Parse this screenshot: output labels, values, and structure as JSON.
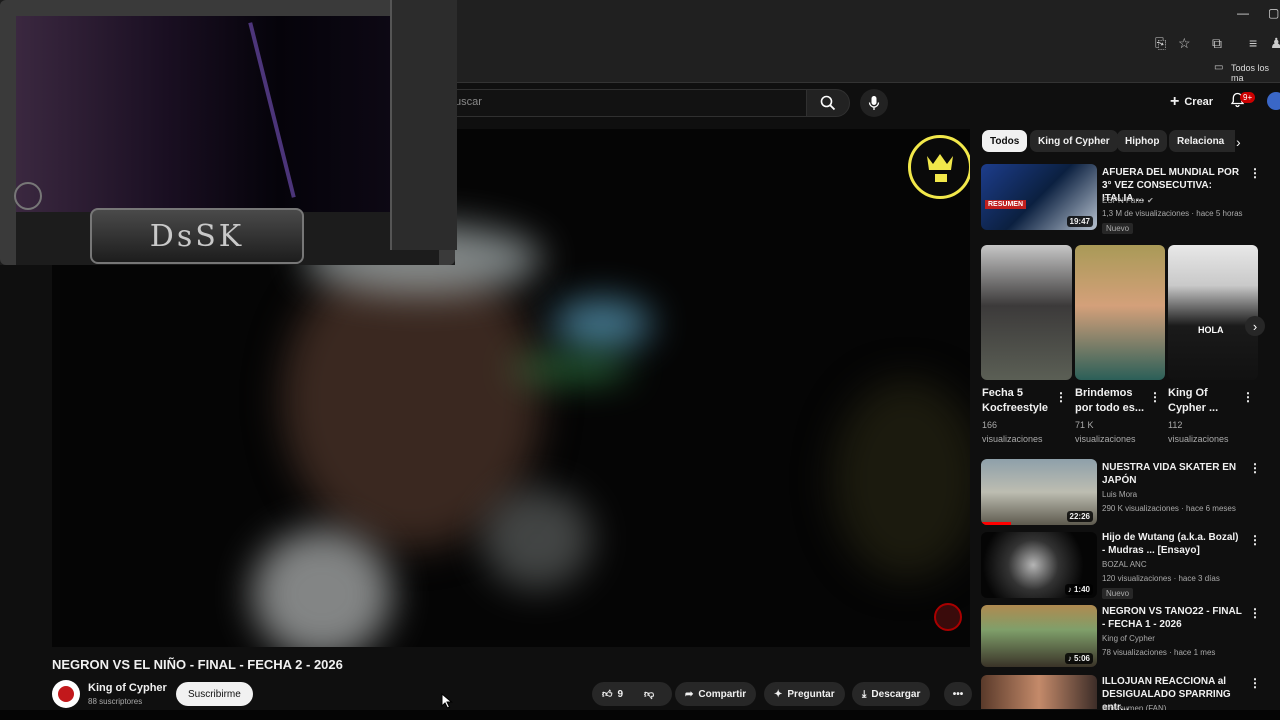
{
  "browser": {
    "bookmark_label": "Todos los ma",
    "bookmark_icon": "folder-icon"
  },
  "header": {
    "search_placeholder": "uscar",
    "create_label": "Crear",
    "notif_badge": "9+"
  },
  "video": {
    "title": "NEGRON VS EL NIÑO - FINAL - FECHA 2 - 2026",
    "overlay_logo_text": "DsSK"
  },
  "channel": {
    "name": "King of Cypher",
    "subs": "88 suscriptores",
    "subscribe_label": "Suscribirme"
  },
  "actions": {
    "likes": "9",
    "share": "Compartir",
    "ask": "Preguntar",
    "download": "Descargar"
  },
  "chips": [
    {
      "label": "Todos",
      "active": true
    },
    {
      "label": "King of Cypher"
    },
    {
      "label": "Hiphop"
    },
    {
      "label": "Relaciona"
    }
  ],
  "recommended": [
    {
      "title": "AFUERA DEL MUNDIAL POR 3° VEZ CONSECUTIVA: ITALIA ...",
      "channel": "ESPN Fans",
      "meta": "1,3 M de visualizaciones · hace 5 horas",
      "badge": "Nuevo",
      "duration": "19:47",
      "thumb_label": "RESUMEN"
    },
    {
      "title": "NUESTRA VIDA SKATER EN JAPÓN",
      "channel": "Luis Mora",
      "meta": "290 K visualizaciones · hace 6 meses",
      "badge": "",
      "duration": "22:26"
    },
    {
      "title": "Hijo de Wutang (a.k.a. Bozal) - Mudras ... [Ensayo]",
      "channel": "BOZAL ANC",
      "meta": "120 visualizaciones · hace 3 días",
      "badge": "Nuevo",
      "duration": "1:40"
    },
    {
      "title": "NEGRON VS TANO22 - FINAL - FECHA 1 - 2026",
      "channel": "King of Cypher",
      "meta": "78 visualizaciones · hace 1 mes",
      "badge": "",
      "duration": "5:06"
    },
    {
      "title": "ILLOJUAN REACCIONA al DESIGUALADO SPARRING entr...",
      "channel": "Illoresumen (FAN)",
      "meta": "",
      "badge": "",
      "duration": ""
    }
  ],
  "shorts": [
    {
      "title1": "Fecha 5",
      "title2": "Kocfreestyle",
      "views1": "166",
      "views2": "visualizaciones"
    },
    {
      "title1": "Brindemos",
      "title2": "por todo es...",
      "views1": "71 K",
      "views2": "visualizaciones"
    },
    {
      "title1": "King Of",
      "title2": "Cypher ...",
      "views1": "112",
      "views2": "visualizaciones",
      "thumb_text": "HOLA"
    }
  ]
}
